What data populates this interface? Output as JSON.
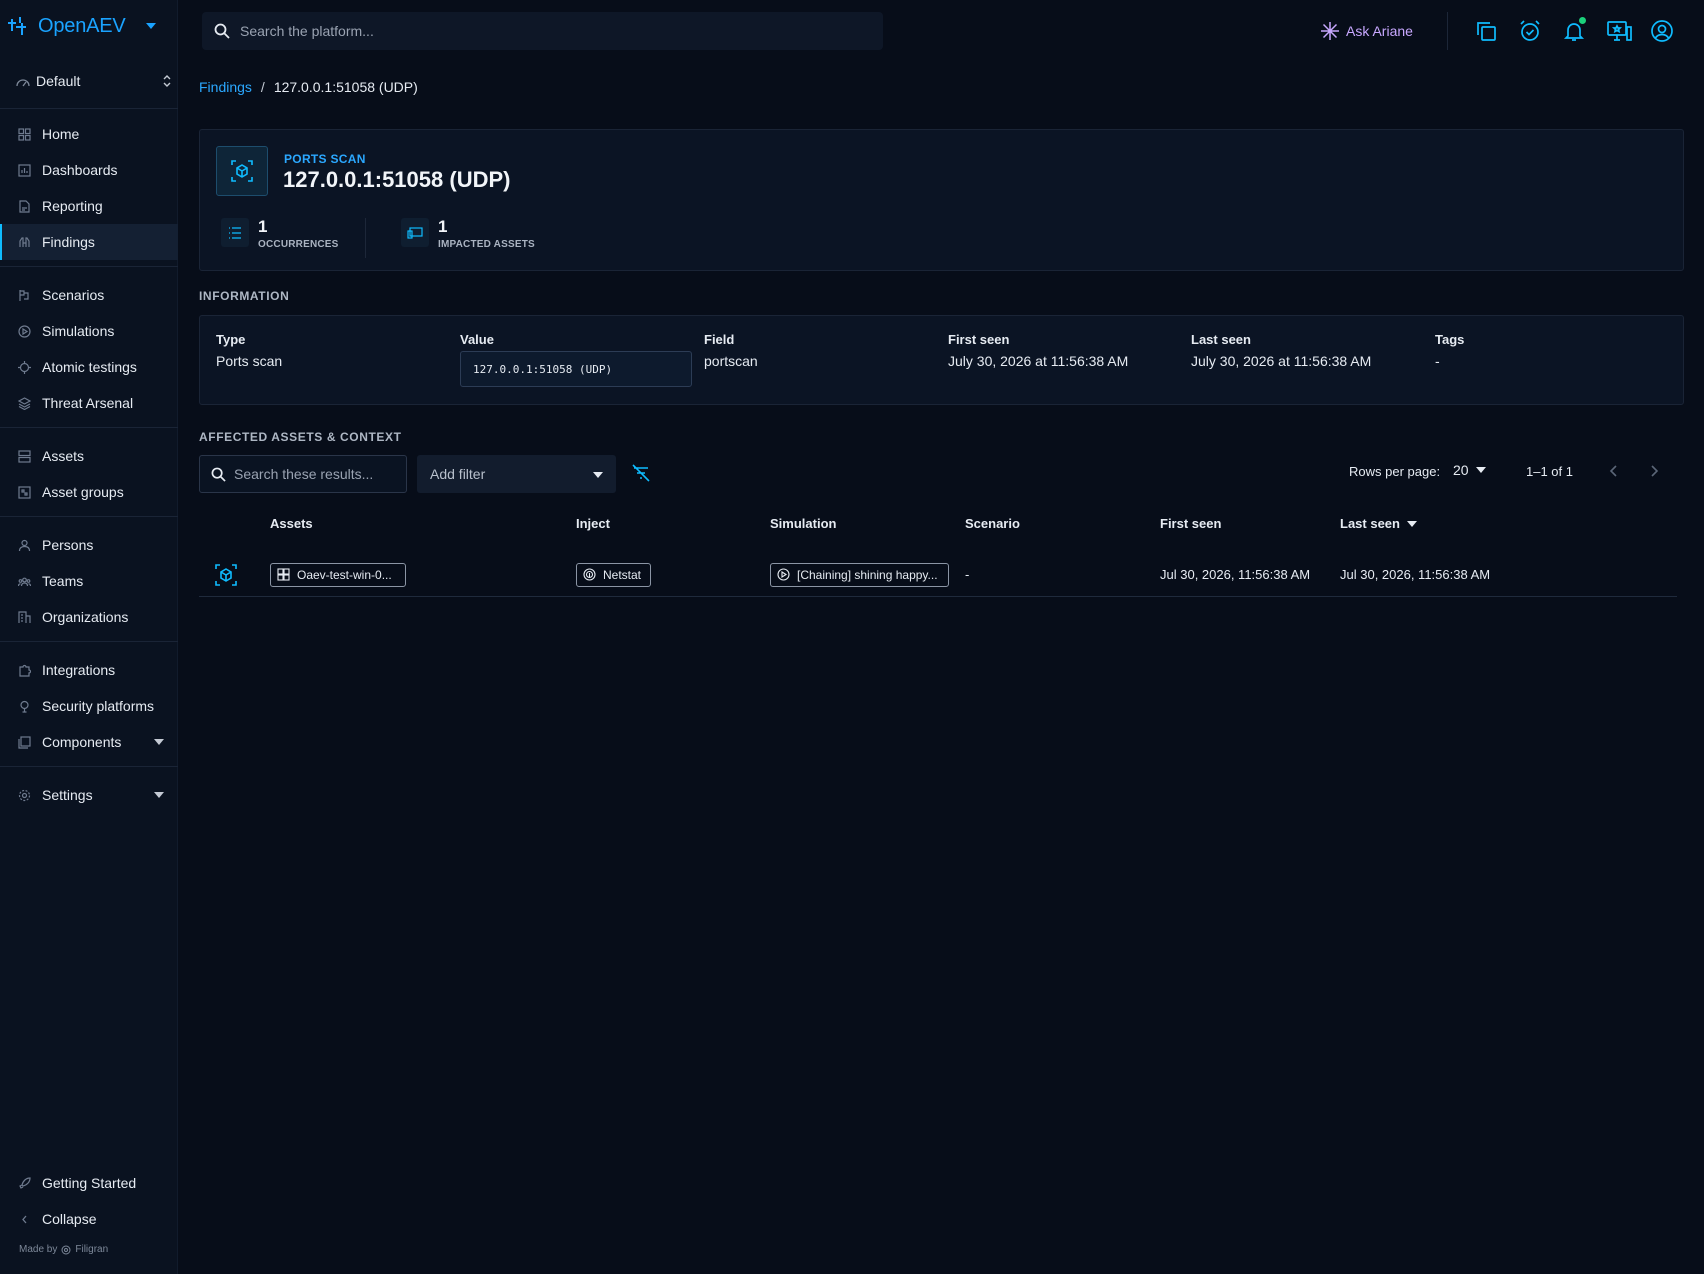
{
  "app": {
    "name": "OpenAEV"
  },
  "workspace": {
    "label": "Default"
  },
  "nav": {
    "home": "Home",
    "dashboards": "Dashboards",
    "reporting": "Reporting",
    "findings": "Findings",
    "scenarios": "Scenarios",
    "simulations": "Simulations",
    "atomic_testings": "Atomic testings",
    "threat_arsenal": "Threat Arsenal",
    "assets": "Assets",
    "asset_groups": "Asset groups",
    "persons": "Persons",
    "teams": "Teams",
    "organizations": "Organizations",
    "integrations": "Integrations",
    "security_platforms": "Security platforms",
    "components": "Components",
    "settings": "Settings",
    "getting_started": "Getting Started",
    "collapse": "Collapse"
  },
  "footer": {
    "made_by": "Made by",
    "vendor": "Filigran"
  },
  "search": {
    "placeholder": "Search the platform..."
  },
  "topbar": {
    "ask_ariane": "Ask Ariane"
  },
  "breadcrumb": {
    "parent": "Findings",
    "separator": "/",
    "current": "127.0.0.1:51058 (UDP)"
  },
  "finding": {
    "kicker": "PORTS SCAN",
    "title": "127.0.0.1:51058 (UDP)",
    "occurrences": {
      "value": "1",
      "label": "OCCURRENCES"
    },
    "impacted_assets": {
      "value": "1",
      "label": "IMPACTED ASSETS"
    }
  },
  "information": {
    "section_title": "INFORMATION",
    "type": {
      "label": "Type",
      "value": "Ports scan"
    },
    "value": {
      "label": "Value",
      "value": "127.0.0.1:51058 (UDP)"
    },
    "field": {
      "label": "Field",
      "value": "portscan"
    },
    "first_seen": {
      "label": "First seen",
      "value": "July 30, 2026 at 11:56:38 AM"
    },
    "last_seen": {
      "label": "Last seen",
      "value": "July 30, 2026 at 11:56:38 AM"
    },
    "tags": {
      "label": "Tags",
      "value": "-"
    }
  },
  "affected": {
    "section_title": "AFFECTED ASSETS & CONTEXT",
    "search_placeholder": "Search these results...",
    "add_filter": "Add filter",
    "rows_per_page_label": "Rows per page:",
    "rows_per_page": "20",
    "range": "1–1 of 1",
    "columns": {
      "assets": "Assets",
      "inject": "Inject",
      "simulation": "Simulation",
      "scenario": "Scenario",
      "first_seen": "First seen",
      "last_seen": "Last seen"
    },
    "rows": [
      {
        "asset": "Oaev-test-win-0...",
        "inject": "Netstat",
        "simulation": "[Chaining] shining happy...",
        "scenario": "-",
        "first_seen": "Jul 30, 2026, 11:56:38 AM",
        "last_seen": "Jul 30, 2026, 11:56:38 AM"
      }
    ]
  },
  "colors": {
    "accent": "#0fbcff",
    "background": "#070d19",
    "ariane": "#c8a8ff",
    "notification_dot": "#1bd07b"
  }
}
